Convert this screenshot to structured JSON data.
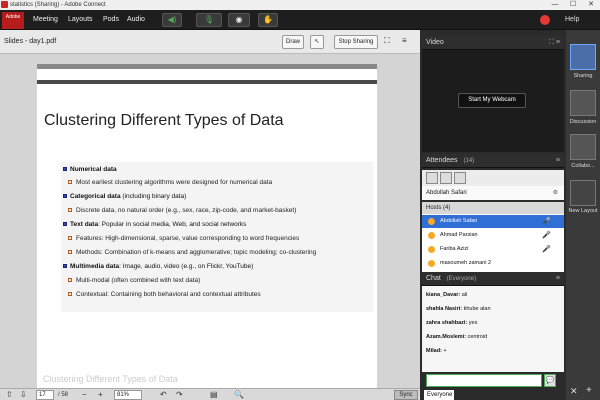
{
  "window": {
    "title": "statistics (Sharing) - Adobe Connect",
    "min": "—",
    "max": "☐",
    "close": "✕"
  },
  "logo": {
    "text": "Adobe"
  },
  "menu": {
    "items": [
      "Meeting",
      "Layouts",
      "Pods",
      "Audio"
    ],
    "help": "Help"
  },
  "slides": {
    "title": "Slides - day1.pdf",
    "draw_label": "Draw",
    "stop_sharing_label": "Stop Sharing",
    "slide_title": "Clustering Different Types of Data",
    "bullets": [
      {
        "level": 1,
        "bold": "Numerical data",
        "text": ""
      },
      {
        "level": 2,
        "bold": "",
        "text": "Most earliest clustering algorithms were designed for numerical data"
      },
      {
        "level": 1,
        "bold": "Categorical data",
        "text": " (including binary data)"
      },
      {
        "level": 2,
        "bold": "",
        "text": "Discrete data, no natural order (e.g., sex, race, zip-code, and market-basket)"
      },
      {
        "level": 1,
        "bold": "Text data",
        "text": ":  Popular in social media, Web, and social networks"
      },
      {
        "level": 2,
        "bold": "",
        "text": "Features:  High-dimensional, sparse, value corresponding to word frequencies"
      },
      {
        "level": 2,
        "bold": "",
        "text": "Methods: Combination of k-means and agglomerative; topic modeling; co-clustering"
      },
      {
        "level": 1,
        "bold": "Multimedia data",
        "text": ": Image, audio, video (e.g., on Flickr, YouTube)"
      },
      {
        "level": 2,
        "bold": "",
        "text": "Multi-modal (often combined with text data)"
      },
      {
        "level": 2,
        "bold": "",
        "text": "Contextual: Containing both behavioral and contextual attributes"
      }
    ],
    "next_slide_peek": "Clustering Different Types of Data"
  },
  "footer": {
    "page": "17",
    "total": "/ 58",
    "zoom": "81%",
    "sync_label": "Sync"
  },
  "video": {
    "title": "Video",
    "webcam_label": "Start My Webcam"
  },
  "attendees": {
    "title": "Attendees",
    "count": "(14)",
    "current_user": "Abdollah Safari",
    "hosts_label": "Hosts (4)",
    "list": [
      "Abdollah Safari",
      "Ahmad Parsian",
      "Fariba Azizi",
      "masoumeh zamani 2"
    ]
  },
  "chat": {
    "title": "Chat",
    "scope": "(Everyone)",
    "messages": [
      {
        "name": "kiana_Davar:",
        "text": "ali"
      },
      {
        "name": "shahla Nasiri:",
        "text": "khube alan"
      },
      {
        "name": "zahra shahbazi:",
        "text": "yes"
      },
      {
        "name": "Azam.Moslemi:",
        "text": "centroid"
      },
      {
        "name": "Milad:",
        "text": "+"
      }
    ],
    "tab": "Everyone"
  },
  "layouts": {
    "items": [
      "Sharing",
      "Discussion",
      "Collabo...",
      "New Layout"
    ]
  }
}
